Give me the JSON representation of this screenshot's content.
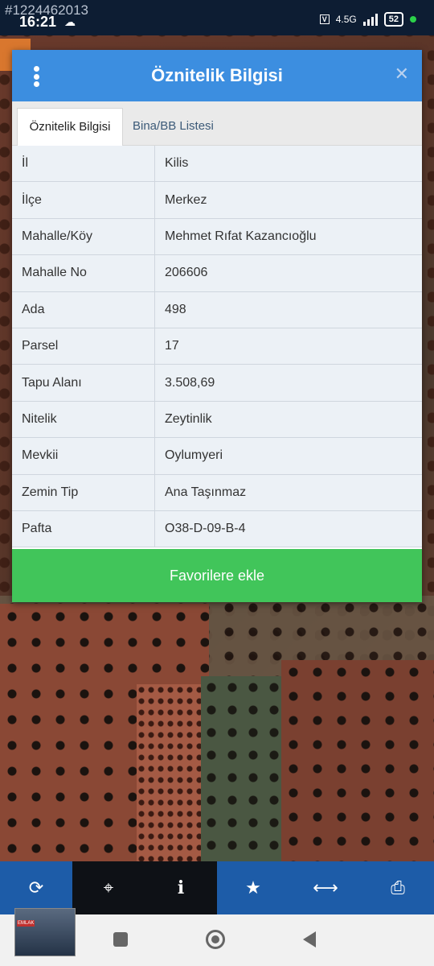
{
  "statusbar": {
    "watermark": "#1224462013",
    "time": "16:21",
    "network": "4.5G",
    "battery": "52"
  },
  "dialog": {
    "title": "Öznitelik Bilgisi",
    "tabs": [
      "Öznitelik Bilgisi",
      "Bina/BB Listesi"
    ],
    "rows": [
      {
        "key": "İl",
        "value": "Kilis"
      },
      {
        "key": "İlçe",
        "value": "Merkez"
      },
      {
        "key": "Mahalle/Köy",
        "value": "Mehmet Rıfat Kazancıoğlu"
      },
      {
        "key": "Mahalle No",
        "value": "206606"
      },
      {
        "key": "Ada",
        "value": "498"
      },
      {
        "key": "Parsel",
        "value": "17"
      },
      {
        "key": "Tapu Alanı",
        "value": "3.508,69"
      },
      {
        "key": "Nitelik",
        "value": "Zeytinlik"
      },
      {
        "key": "Mevkii",
        "value": "Oylumyeri"
      },
      {
        "key": "Zemin Tip",
        "value": "Ana Taşınmaz"
      },
      {
        "key": "Pafta",
        "value": "O38-D-09-B-4"
      }
    ],
    "favorite_button": "Favorilere ekle"
  },
  "toolbar": {
    "icons": [
      "refresh-icon",
      "locate-icon",
      "info-icon",
      "star-icon",
      "measure-icon",
      "print-icon"
    ]
  },
  "colors": {
    "header_blue": "#3c8ee0",
    "favorite_green": "#41c55a",
    "toolbar_blue": "#1d5ca8"
  }
}
